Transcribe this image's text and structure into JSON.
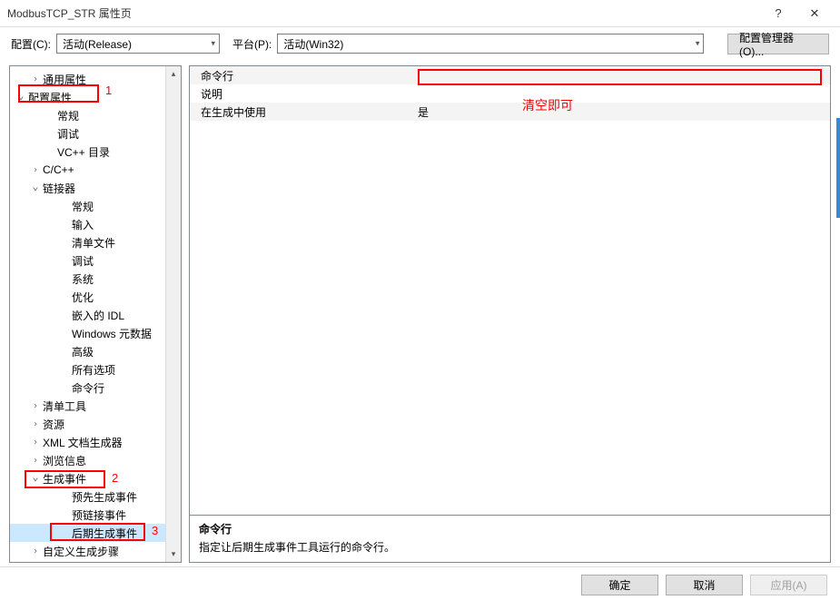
{
  "window": {
    "title": "ModbusTCP_STR 属性页",
    "help_symbol": "?",
    "close_symbol": "✕"
  },
  "config_bar": {
    "config_label": "配置(C):",
    "config_value": "活动(Release)",
    "platform_label": "平台(P):",
    "platform_value": "活动(Win32)",
    "manager_btn": "配置管理器(O)..."
  },
  "tree": {
    "items": [
      {
        "label": "通用属性",
        "indent": 1,
        "exp": ">"
      },
      {
        "label": "配置属性",
        "indent": 0,
        "exp": "v"
      },
      {
        "label": "常规",
        "indent": 2,
        "exp": ""
      },
      {
        "label": "调试",
        "indent": 2,
        "exp": ""
      },
      {
        "label": "VC++ 目录",
        "indent": 2,
        "exp": ""
      },
      {
        "label": "C/C++",
        "indent": 1,
        "exp": ">"
      },
      {
        "label": "链接器",
        "indent": 1,
        "exp": "v"
      },
      {
        "label": "常规",
        "indent": 3,
        "exp": ""
      },
      {
        "label": "输入",
        "indent": 3,
        "exp": ""
      },
      {
        "label": "清单文件",
        "indent": 3,
        "exp": ""
      },
      {
        "label": "调试",
        "indent": 3,
        "exp": ""
      },
      {
        "label": "系统",
        "indent": 3,
        "exp": ""
      },
      {
        "label": "优化",
        "indent": 3,
        "exp": ""
      },
      {
        "label": "嵌入的 IDL",
        "indent": 3,
        "exp": ""
      },
      {
        "label": "Windows 元数据",
        "indent": 3,
        "exp": ""
      },
      {
        "label": "高级",
        "indent": 3,
        "exp": ""
      },
      {
        "label": "所有选项",
        "indent": 3,
        "exp": ""
      },
      {
        "label": "命令行",
        "indent": 3,
        "exp": ""
      },
      {
        "label": "清单工具",
        "indent": 1,
        "exp": ">"
      },
      {
        "label": "资源",
        "indent": 1,
        "exp": ">"
      },
      {
        "label": "XML 文档生成器",
        "indent": 1,
        "exp": ">"
      },
      {
        "label": "浏览信息",
        "indent": 1,
        "exp": ">"
      },
      {
        "label": "生成事件",
        "indent": 1,
        "exp": "v"
      },
      {
        "label": "预先生成事件",
        "indent": 3,
        "exp": ""
      },
      {
        "label": "预链接事件",
        "indent": 3,
        "exp": ""
      },
      {
        "label": "后期生成事件",
        "indent": 3,
        "exp": "",
        "selected": true
      },
      {
        "label": "自定义生成步骤",
        "indent": 1,
        "exp": ">"
      }
    ]
  },
  "props": {
    "rows": [
      {
        "name": "命令行",
        "value": ""
      },
      {
        "name": "说明",
        "value": ""
      },
      {
        "name": "在生成中使用",
        "value": "是"
      }
    ]
  },
  "desc": {
    "title": "命令行",
    "text": "指定让后期生成事件工具运行的命令行。"
  },
  "buttons": {
    "ok": "确定",
    "cancel": "取消",
    "apply": "应用(A)"
  },
  "annotations": {
    "a1": "1",
    "a2": "2",
    "a3": "3",
    "clear_hint": "清空即可"
  }
}
